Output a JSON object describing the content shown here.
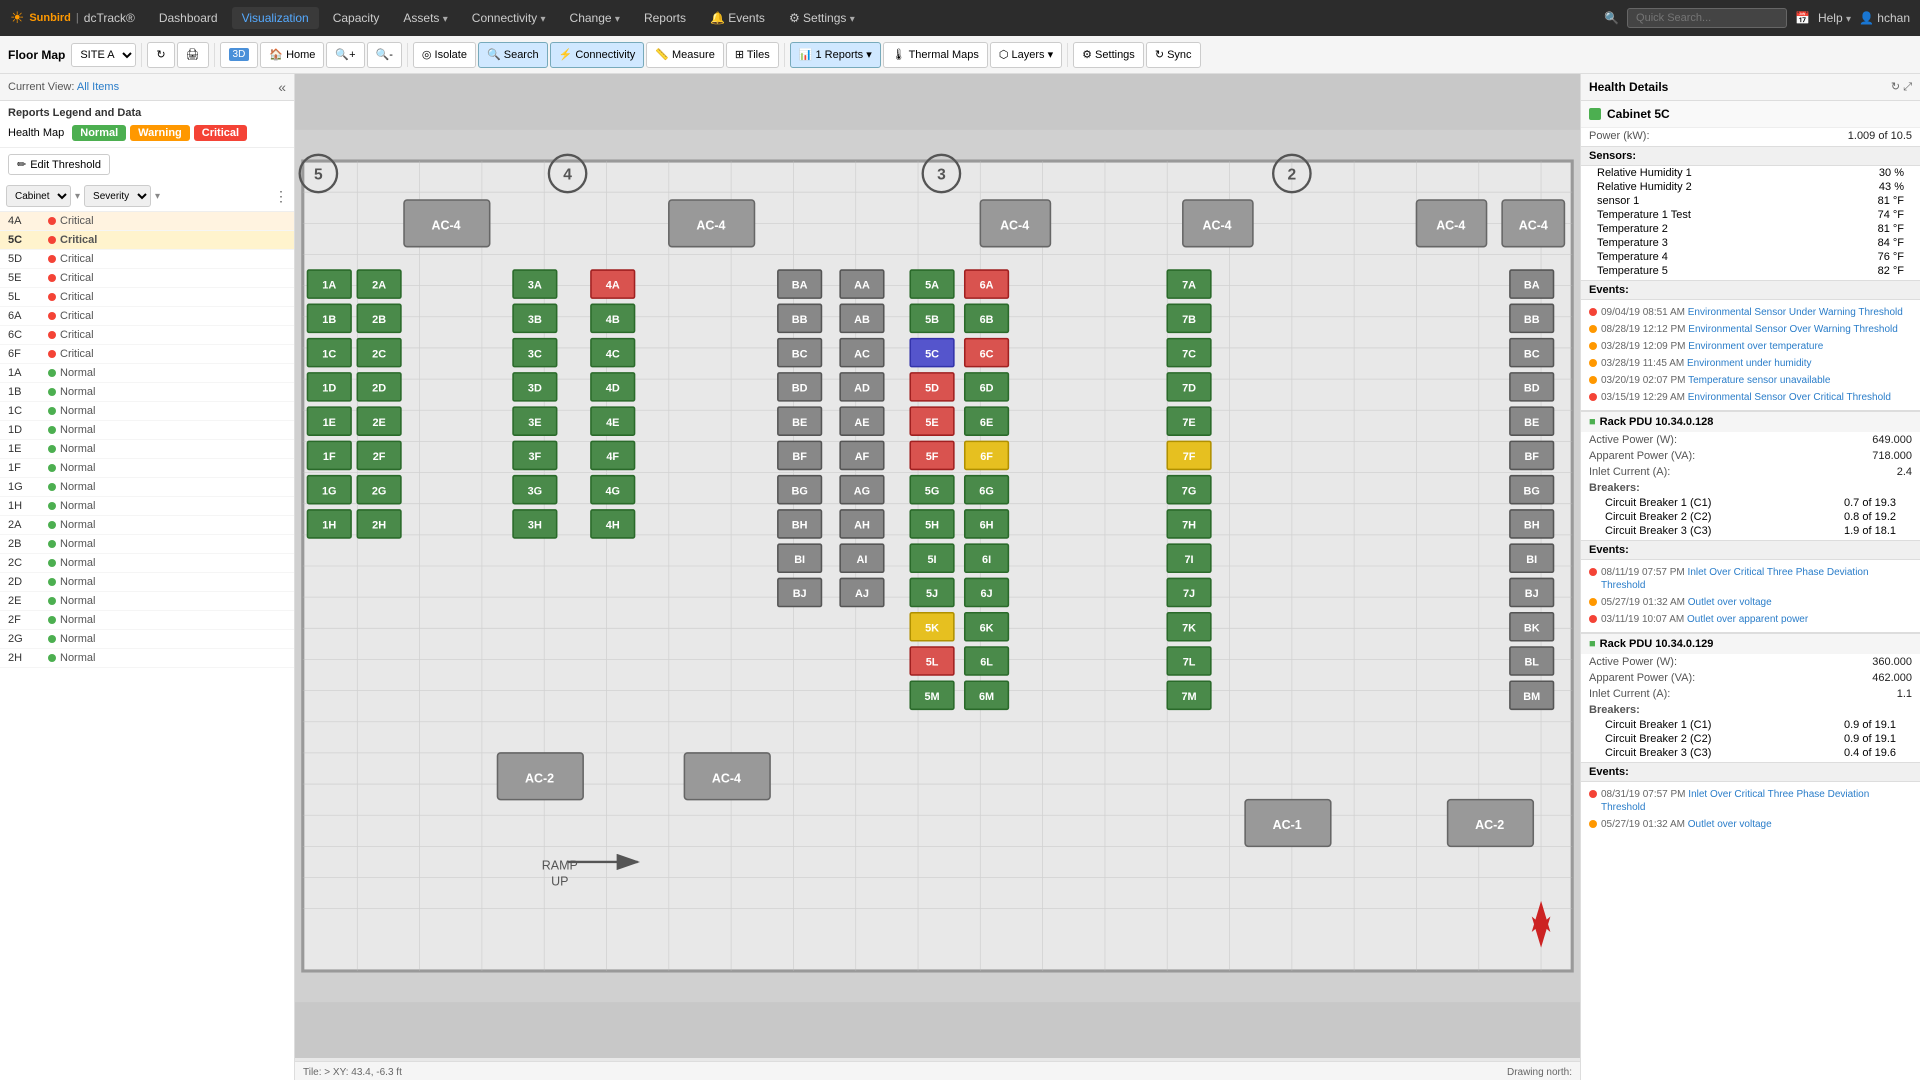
{
  "app": {
    "logo": "☀",
    "brand": "Sunbird",
    "product": "dcTrack®"
  },
  "topnav": {
    "items": [
      {
        "label": "Dashboard",
        "active": false
      },
      {
        "label": "Visualization",
        "active": true
      },
      {
        "label": "Capacity",
        "active": false
      },
      {
        "label": "Assets",
        "active": false,
        "arrow": "▾"
      },
      {
        "label": "Connectivity",
        "active": false,
        "arrow": "▾"
      },
      {
        "label": "Change",
        "active": false,
        "arrow": "▾"
      },
      {
        "label": "Reports",
        "active": false
      },
      {
        "label": "🔔 Events",
        "active": false
      },
      {
        "label": "⚙ Settings",
        "active": false,
        "arrow": "▾"
      }
    ],
    "search_placeholder": "Quick Search...",
    "calendar_icon": "📅",
    "help_label": "Help",
    "user_label": "hchan"
  },
  "toolbar": {
    "floor_map_label": "Floor Map",
    "site_label": "SITE A",
    "buttons": [
      {
        "id": "refresh",
        "icon": "↻",
        "label": ""
      },
      {
        "id": "print",
        "icon": "🖨",
        "label": ""
      },
      {
        "id": "3d",
        "icon": "⬛",
        "label": "3D"
      },
      {
        "id": "home",
        "icon": "🏠",
        "label": "Home"
      },
      {
        "id": "zoom-in",
        "icon": "+",
        "label": ""
      },
      {
        "id": "zoom-out",
        "icon": "-",
        "label": ""
      },
      {
        "id": "isolate",
        "icon": "◎",
        "label": "Isolate"
      },
      {
        "id": "search",
        "icon": "🔍",
        "label": "Search"
      },
      {
        "id": "connectivity",
        "icon": "⚡",
        "label": "Connectivity"
      },
      {
        "id": "measure",
        "icon": "📏",
        "label": "Measure"
      },
      {
        "id": "tiles",
        "icon": "⊞",
        "label": "Tiles"
      },
      {
        "id": "reports",
        "icon": "📊",
        "label": "1 Reports",
        "arrow": "▾"
      },
      {
        "id": "thermal",
        "icon": "🌡",
        "label": "Thermal Maps"
      },
      {
        "id": "layers",
        "icon": "⬡",
        "label": "Layers",
        "arrow": "▾"
      },
      {
        "id": "settings",
        "icon": "⚙",
        "label": "Settings"
      },
      {
        "id": "sync",
        "icon": "↻",
        "label": "Sync"
      }
    ]
  },
  "left_panel": {
    "current_view_label": "Current View:",
    "current_view_value": "All Items",
    "legend_title": "Reports Legend and Data",
    "health_map_label": "Health Map",
    "badges": {
      "normal": "Normal",
      "warning": "Warning",
      "critical": "Critical"
    },
    "edit_threshold_label": "Edit Threshold",
    "filters": {
      "cabinet_label": "Cabinet",
      "severity_label": "Severity"
    },
    "cabinets": [
      {
        "name": "4A",
        "severity": "Critical",
        "type": "critical"
      },
      {
        "name": "5C",
        "severity": "Critical",
        "type": "critical",
        "selected": true
      },
      {
        "name": "5D",
        "severity": "Critical",
        "type": "critical"
      },
      {
        "name": "5E",
        "severity": "Critical",
        "type": "critical"
      },
      {
        "name": "5L",
        "severity": "Critical",
        "type": "critical"
      },
      {
        "name": "6A",
        "severity": "Critical",
        "type": "critical"
      },
      {
        "name": "6C",
        "severity": "Critical",
        "type": "critical"
      },
      {
        "name": "6F",
        "severity": "Critical",
        "type": "critical"
      },
      {
        "name": "1A",
        "severity": "Normal",
        "type": "normal"
      },
      {
        "name": "1B",
        "severity": "Normal",
        "type": "normal"
      },
      {
        "name": "1C",
        "severity": "Normal",
        "type": "normal"
      },
      {
        "name": "1D",
        "severity": "Normal",
        "type": "normal"
      },
      {
        "name": "1E",
        "severity": "Normal",
        "type": "normal"
      },
      {
        "name": "1F",
        "severity": "Normal",
        "type": "normal"
      },
      {
        "name": "1G",
        "severity": "Normal",
        "type": "normal"
      },
      {
        "name": "1H",
        "severity": "Normal",
        "type": "normal"
      },
      {
        "name": "2A",
        "severity": "Normal",
        "type": "normal"
      },
      {
        "name": "2B",
        "severity": "Normal",
        "type": "normal"
      },
      {
        "name": "2C",
        "severity": "Normal",
        "type": "normal"
      },
      {
        "name": "2D",
        "severity": "Normal",
        "type": "normal"
      },
      {
        "name": "2E",
        "severity": "Normal",
        "type": "normal"
      },
      {
        "name": "2F",
        "severity": "Normal",
        "type": "normal"
      },
      {
        "name": "2G",
        "severity": "Normal",
        "type": "normal"
      },
      {
        "name": "2H",
        "severity": "Normal",
        "type": "normal"
      }
    ]
  },
  "floor_map": {
    "title": "Floor Map",
    "tile_info": "Tile: >  XY: 43.4, -6.3 ft",
    "drawing_north": "Drawing north:"
  },
  "right_panel": {
    "title": "Health Details",
    "cabinet_name": "Cabinet 5C",
    "power_kw_label": "Power (kW):",
    "power_kw_value": "1.009 of 10.5",
    "sensors_label": "Sensors:",
    "sensors": [
      {
        "name": "Relative Humidity 1",
        "value": "30 %"
      },
      {
        "name": "Relative Humidity 2",
        "value": "43 %"
      },
      {
        "name": "sensor 1",
        "value": "81 °F"
      },
      {
        "name": "Temperature 1 Test",
        "value": "74 °F"
      },
      {
        "name": "Temperature 2",
        "value": "81 °F"
      },
      {
        "name": "Temperature 3",
        "value": "84 °F"
      },
      {
        "name": "Temperature 4",
        "value": "76 °F"
      },
      {
        "name": "Temperature 5",
        "value": "82 °F"
      }
    ],
    "events_label": "Events:",
    "events": [
      {
        "date": "09/04/19 08:51 AM",
        "text": "Environmental Sensor Under Warning Threshold",
        "color": "red"
      },
      {
        "date": "08/28/19 12:12 PM",
        "text": "Environmental Sensor Over Warning Threshold",
        "color": "yellow"
      },
      {
        "date": "03/28/19 12:09 PM",
        "text": "Environment over temperature",
        "color": "yellow"
      },
      {
        "date": "03/28/19 11:45 AM",
        "text": "Environment under humidity",
        "color": "yellow"
      },
      {
        "date": "03/20/19 02:07 PM",
        "text": "Temperature sensor unavailable",
        "color": "yellow"
      },
      {
        "date": "03/15/19 12:29 AM",
        "text": "Environmental Sensor Over Critical Threshold",
        "color": "red"
      }
    ],
    "pdu1": {
      "name": "Rack PDU 10.34.0.128",
      "active_power_label": "Active Power (W):",
      "active_power_value": "649.000",
      "apparent_power_label": "Apparent Power (VA):",
      "apparent_power_value": "718.000",
      "inlet_current_label": "Inlet Current (A):",
      "inlet_current_value": "2.4",
      "breakers_label": "Breakers:",
      "breakers": [
        {
          "name": "Circuit Breaker 1 (C1)",
          "value": "0.7 of 19.3"
        },
        {
          "name": "Circuit Breaker 2 (C2)",
          "value": "0.8 of 19.2"
        },
        {
          "name": "Circuit Breaker 3 (C3)",
          "value": "1.9 of 18.1"
        }
      ],
      "events": [
        {
          "date": "08/11/19 07:57 PM",
          "text": "Inlet Over Critical Three Phase Deviation Threshold",
          "color": "red"
        },
        {
          "date": "05/27/19 01:32 AM",
          "text": "Outlet over voltage",
          "color": "yellow"
        },
        {
          "date": "03/11/19 10:07 AM",
          "text": "Outlet over apparent power",
          "color": "red"
        }
      ]
    },
    "pdu2": {
      "name": "Rack PDU 10.34.0.129",
      "active_power_label": "Active Power (W):",
      "active_power_value": "360.000",
      "apparent_power_label": "Apparent Power (VA):",
      "apparent_power_value": "462.000",
      "inlet_current_label": "Inlet Current (A):",
      "inlet_current_value": "1.1",
      "breakers_label": "Breakers:",
      "breakers": [
        {
          "name": "Circuit Breaker 1 (C1)",
          "value": "0.9 of 19.1"
        },
        {
          "name": "Circuit Breaker 2 (C2)",
          "value": "0.9 of 19.1"
        },
        {
          "name": "Circuit Breaker 3 (C3)",
          "value": "0.4 of 19.6"
        }
      ],
      "events": [
        {
          "date": "08/31/19 07:57 PM",
          "text": "Inlet Over Critical Three Phase Deviation Threshold",
          "color": "red"
        },
        {
          "date": "05/27/19 01:32 AM",
          "text": "Outlet over voltage",
          "color": "yellow"
        }
      ]
    }
  },
  "status_bar": {
    "tile_info": "Tile: >  XY: 43.4, -6.3 ft",
    "drawing_north": "Drawing north:"
  }
}
